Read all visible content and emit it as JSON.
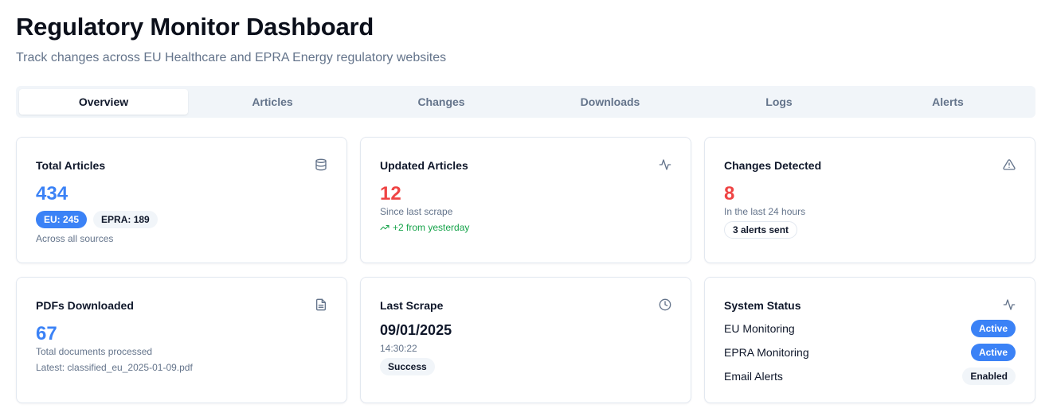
{
  "header": {
    "title": "Regulatory Monitor Dashboard",
    "subtitle": "Track changes across EU Healthcare and EPRA Energy regulatory websites"
  },
  "tabs": [
    {
      "label": "Overview",
      "active": true
    },
    {
      "label": "Articles",
      "active": false
    },
    {
      "label": "Changes",
      "active": false
    },
    {
      "label": "Downloads",
      "active": false
    },
    {
      "label": "Logs",
      "active": false
    },
    {
      "label": "Alerts",
      "active": false
    }
  ],
  "cards": {
    "total_articles": {
      "title": "Total Articles",
      "icon": "database-icon",
      "value": "434",
      "badges": [
        "EU: 245",
        "EPRA: 189"
      ],
      "caption": "Across all sources"
    },
    "updated_articles": {
      "title": "Updated Articles",
      "icon": "activity-icon",
      "value": "12",
      "caption": "Since last scrape",
      "trend": "+2 from yesterday"
    },
    "changes_detected": {
      "title": "Changes Detected",
      "icon": "alert-triangle-icon",
      "value": "8",
      "caption": "In the last 24 hours",
      "badge": "3 alerts sent"
    },
    "pdfs_downloaded": {
      "title": "PDFs Downloaded",
      "icon": "file-text-icon",
      "value": "67",
      "caption": "Total documents processed",
      "latest": "Latest: classified_eu_2025-01-09.pdf"
    },
    "last_scrape": {
      "title": "Last Scrape",
      "icon": "clock-icon",
      "date": "09/01/2025",
      "time": "14:30:22",
      "status": "Success"
    },
    "system_status": {
      "title": "System Status",
      "icon": "activity-icon",
      "rows": [
        {
          "label": "EU Monitoring",
          "status": "Active"
        },
        {
          "label": "EPRA Monitoring",
          "status": "Active"
        },
        {
          "label": "Email Alerts",
          "status": "Enabled"
        }
      ]
    }
  },
  "colors": {
    "accent_blue": "#3b82f6",
    "accent_red": "#ef4444",
    "trend_green": "#16a34a",
    "muted_text": "#64748b"
  }
}
